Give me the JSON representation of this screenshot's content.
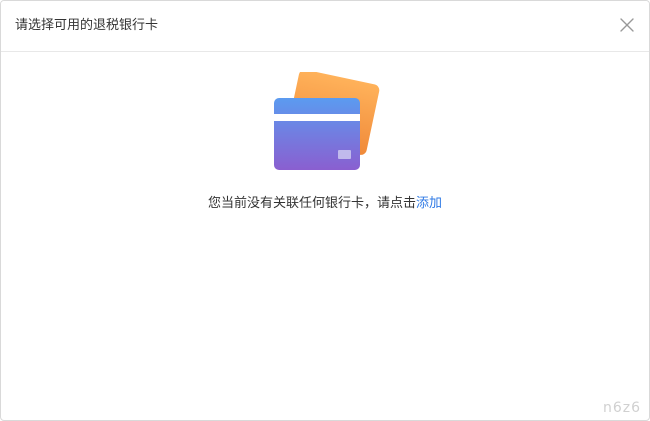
{
  "dialog": {
    "title": "请选择可用的退税银行卡",
    "close_icon": "close-icon"
  },
  "empty_state": {
    "illustration_icon": "bank-card-icon",
    "message": "您当前没有关联任何银行卡，请点击",
    "add_link": "添加"
  },
  "colors": {
    "link": "#2f7ae5",
    "card_front_top": "#5b9bf0",
    "card_front_bottom": "#8a5fd0",
    "card_back": "#f5a04a"
  },
  "watermark": "n6z6"
}
